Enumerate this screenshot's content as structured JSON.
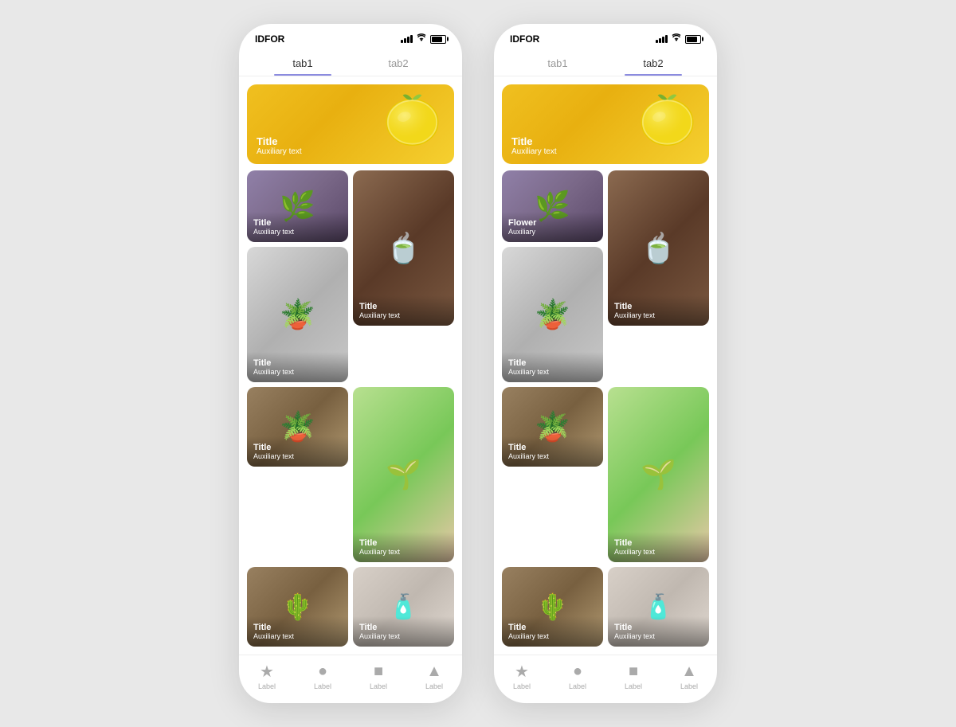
{
  "phones": [
    {
      "id": "phone-1",
      "status_bar": {
        "app_name": "IDFOR",
        "icons": [
          "signal",
          "wifi",
          "battery"
        ]
      },
      "tabs": [
        {
          "label": "tab1",
          "active": true
        },
        {
          "label": "tab2",
          "active": false
        }
      ],
      "hero": {
        "title": "Title",
        "aux": "Auxiliary text"
      },
      "grid_items": [
        {
          "title": "Title",
          "aux": "Auxiliary text",
          "type": "flowers",
          "span": "normal"
        },
        {
          "title": "Title",
          "aux": "Auxiliary text",
          "type": "spices",
          "span": "tall"
        },
        {
          "title": "Title",
          "aux": "Auxiliary text",
          "type": "plant-gray",
          "span": "tall"
        },
        {
          "title": "Title",
          "aux": "Auxiliary text",
          "type": "plant-green",
          "span": "tall"
        },
        {
          "title": "Title",
          "aux": "Auxiliary text",
          "type": "snake",
          "span": "normal"
        },
        {
          "title": "Title",
          "aux": "Auxiliary text",
          "type": "bottles",
          "span": "normal"
        }
      ],
      "bottom_nav": [
        {
          "icon": "★",
          "label": "Label"
        },
        {
          "icon": "●",
          "label": "Label"
        },
        {
          "icon": "■",
          "label": "Label"
        },
        {
          "icon": "▲",
          "label": "Label"
        }
      ]
    },
    {
      "id": "phone-2",
      "status_bar": {
        "app_name": "IDFOR",
        "icons": [
          "signal",
          "wifi",
          "battery"
        ]
      },
      "tabs": [
        {
          "label": "tab1",
          "active": false
        },
        {
          "label": "tab2",
          "active": true
        }
      ],
      "hero": {
        "title": "Title",
        "aux": "Auxiliary text"
      },
      "grid_items": [
        {
          "title": "Flower",
          "aux": "Auxiliary",
          "type": "flowers",
          "span": "normal"
        },
        {
          "title": "Title",
          "aux": "Auxiliary text",
          "type": "spices",
          "span": "tall"
        },
        {
          "title": "Title",
          "aux": "Auxiliary text",
          "type": "plant-gray",
          "span": "tall"
        },
        {
          "title": "Title",
          "aux": "Auxiliary text",
          "type": "plant-green",
          "span": "tall"
        },
        {
          "title": "Title",
          "aux": "Auxiliary text",
          "type": "snake",
          "span": "normal"
        },
        {
          "title": "Title",
          "aux": "Auxiliary text",
          "type": "bottles",
          "span": "normal"
        }
      ],
      "bottom_nav": [
        {
          "icon": "★",
          "label": "Label"
        },
        {
          "icon": "●",
          "label": "Label"
        },
        {
          "icon": "■",
          "label": "Label"
        },
        {
          "icon": "▲",
          "label": "Label"
        }
      ]
    }
  ],
  "accent_color": "#8b8bdf",
  "active_tab_color": "#8b8bdf"
}
